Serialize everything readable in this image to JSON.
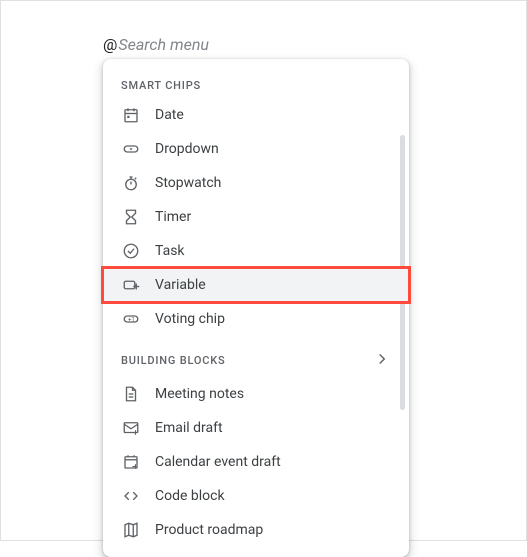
{
  "search": {
    "at": "@",
    "placeholder": "Search menu"
  },
  "sections": {
    "smart_chips": {
      "header": "SMART CHIPS",
      "items": [
        {
          "icon": "date-icon",
          "label": "Date"
        },
        {
          "icon": "dropdown-icon",
          "label": "Dropdown"
        },
        {
          "icon": "stopwatch-icon",
          "label": "Stopwatch"
        },
        {
          "icon": "timer-icon",
          "label": "Timer"
        },
        {
          "icon": "task-icon",
          "label": "Task"
        },
        {
          "icon": "variable-icon",
          "label": "Variable",
          "highlighted": true
        },
        {
          "icon": "voting-chip-icon",
          "label": "Voting chip"
        }
      ]
    },
    "building_blocks": {
      "header": "BUILDING BLOCKS",
      "items": [
        {
          "icon": "meeting-notes-icon",
          "label": "Meeting notes"
        },
        {
          "icon": "email-draft-icon",
          "label": "Email draft"
        },
        {
          "icon": "calendar-event-icon",
          "label": "Calendar event draft"
        },
        {
          "icon": "code-block-icon",
          "label": "Code block"
        },
        {
          "icon": "product-roadmap-icon",
          "label": "Product roadmap"
        }
      ]
    }
  }
}
